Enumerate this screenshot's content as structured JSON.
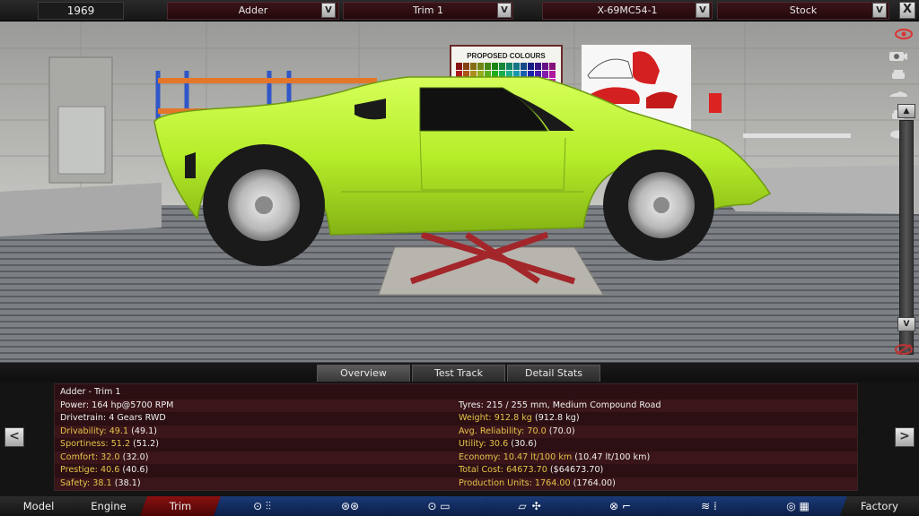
{
  "topbar": {
    "year": "1969",
    "model": "Adder",
    "trim": "Trim 1",
    "engine": "X-69MC54-1",
    "variant": "Stock",
    "dropdown_glyph": "V",
    "close_glyph": "X"
  },
  "scene": {
    "poster_title": "PROPOSED COLOURS",
    "car_color": "#b9f231"
  },
  "tabs": [
    "Overview",
    "Test Track",
    "Detail Stats"
  ],
  "stats": {
    "title": "Adder - Trim 1",
    "left": [
      {
        "label": "Power:",
        "value": "164 hp@5700 RPM",
        "paren": "",
        "highlight": false
      },
      {
        "label": "Drivetrain:",
        "value": "4 Gears RWD",
        "paren": "",
        "highlight": false
      },
      {
        "label": "Drivability:",
        "value": "49.1",
        "paren": "(49.1)",
        "highlight": true
      },
      {
        "label": "Sportiness:",
        "value": "51.2",
        "paren": "(51.2)",
        "highlight": true
      },
      {
        "label": "Comfort:",
        "value": "32.0",
        "paren": "(32.0)",
        "highlight": true
      },
      {
        "label": "Prestige:",
        "value": "40.6",
        "paren": "(40.6)",
        "highlight": true
      },
      {
        "label": "Safety:",
        "value": "38.1",
        "paren": "(38.1)",
        "highlight": true
      }
    ],
    "right": [
      {
        "label": "",
        "value": "",
        "paren": "",
        "highlight": false
      },
      {
        "label": "Tyres:",
        "value": "215 / 255 mm, Medium Compound Road",
        "paren": "",
        "highlight": false
      },
      {
        "label": "Weight:",
        "value": "912.8 kg",
        "paren": "(912.8 kg)",
        "highlight": true
      },
      {
        "label": "Avg. Reliability:",
        "value": "70.0",
        "paren": "(70.0)",
        "highlight": true
      },
      {
        "label": "Utility:",
        "value": "30.6",
        "paren": "(30.6)",
        "highlight": true
      },
      {
        "label": "Economy:",
        "value": "10.47 lt/100 km",
        "paren": "(10.47 lt/100 km)",
        "highlight": true
      },
      {
        "label": "Total Cost:",
        "value": "64673.70",
        "paren": "($64673.70)",
        "highlight": true
      },
      {
        "label": "Production Units:",
        "value": "1764.00",
        "paren": "(1764.00)",
        "highlight": true
      }
    ],
    "prev_glyph": "<",
    "next_glyph": ">"
  },
  "bottomnav": {
    "model": "Model",
    "engine": "Engine",
    "trim": "Trim",
    "factory": "Factory",
    "icons": [
      "chassis-gearbox-icon",
      "wheels-icon",
      "body-icon",
      "car-body-icon",
      "fan-icon",
      "steering-seat-icon",
      "suspension-icon",
      "testing-icon"
    ]
  }
}
